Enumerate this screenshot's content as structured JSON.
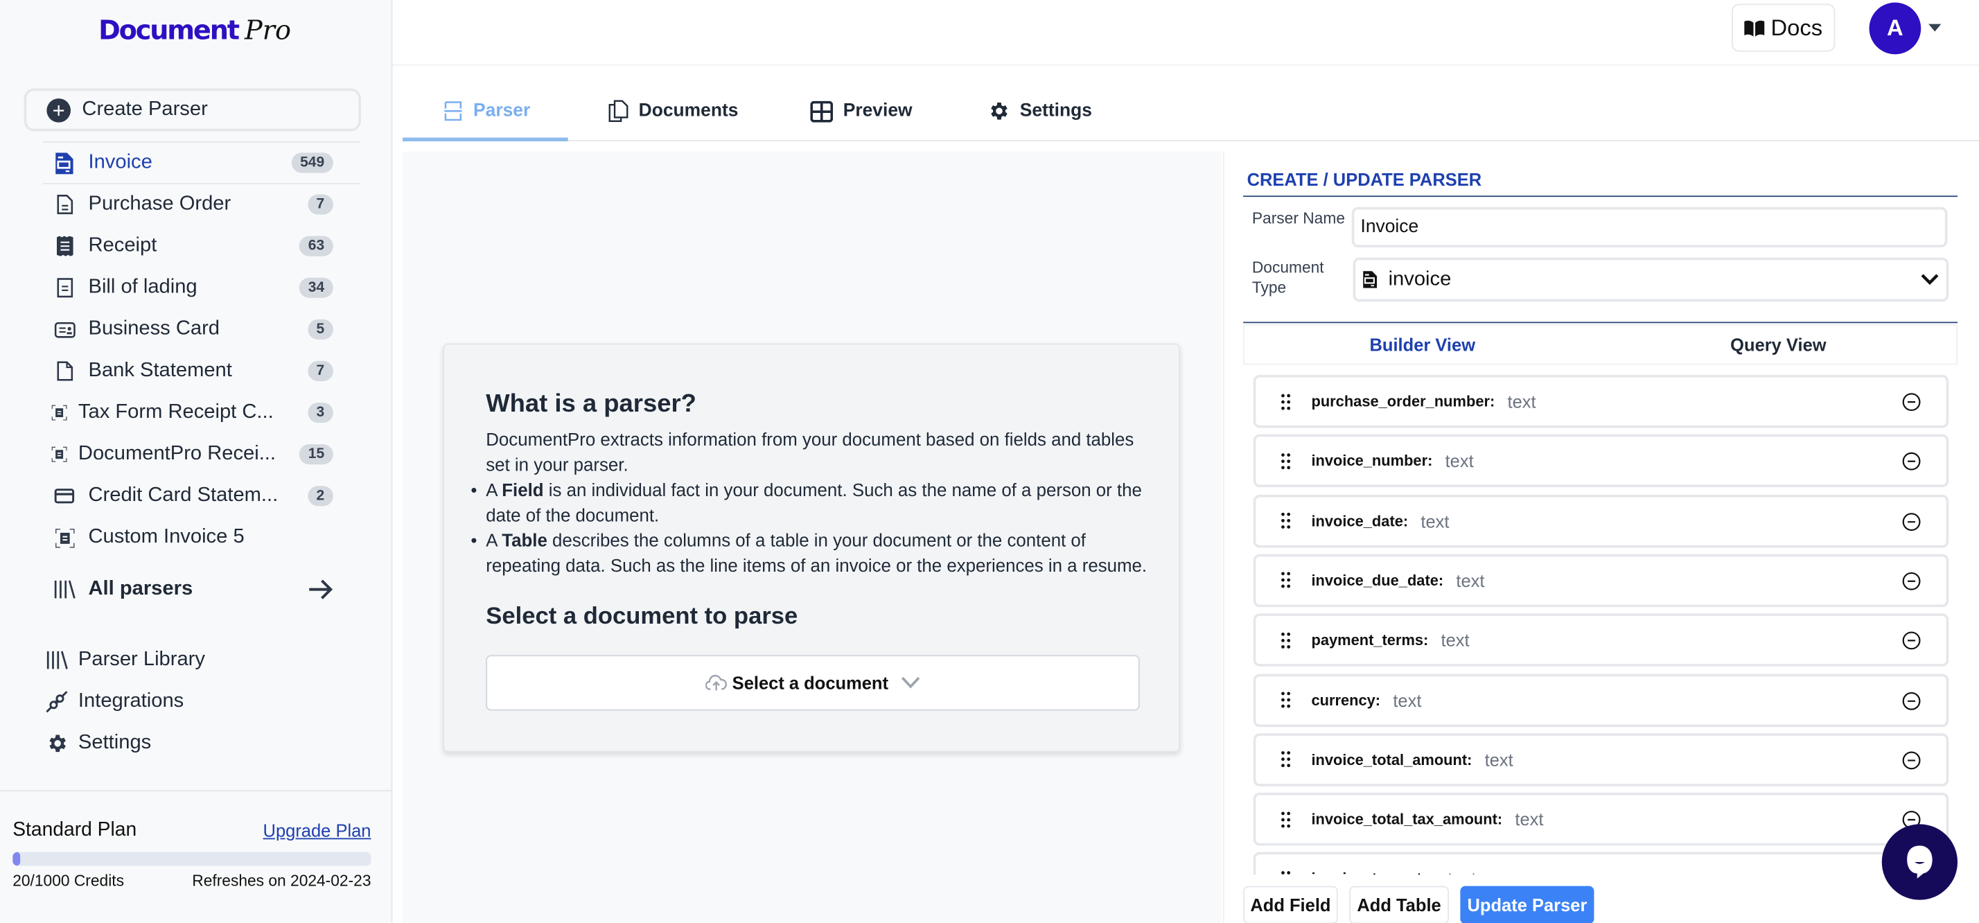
{
  "app": {
    "logo_main": "Document",
    "logo_accent": "Pro"
  },
  "sidebar": {
    "create_label": "Create Parser",
    "parsers": [
      {
        "label": "Invoice",
        "count": "549",
        "icon": "invoice-icon",
        "active": true
      },
      {
        "label": "Purchase Order",
        "count": "7",
        "icon": "document-outline-icon"
      },
      {
        "label": "Receipt",
        "count": "63",
        "icon": "receipt-icon"
      },
      {
        "label": "Bill of lading",
        "count": "34",
        "icon": "document-lines-icon"
      },
      {
        "label": "Business Card",
        "count": "5",
        "icon": "business-card-icon"
      },
      {
        "label": "Bank Statement",
        "count": "7",
        "icon": "blank-document-icon"
      },
      {
        "label": "Tax Form Receipt C...",
        "count": "3",
        "icon": "scan-document-icon"
      },
      {
        "label": "DocumentPro Recei...",
        "count": "15",
        "icon": "scan-document-icon"
      },
      {
        "label": "Credit Card Statem...",
        "count": "2",
        "icon": "credit-card-icon"
      },
      {
        "label": "Custom Invoice 5",
        "count": "",
        "icon": "scan-document-icon"
      }
    ],
    "all_parsers_label": "All parsers",
    "bottom_nav": [
      {
        "label": "Parser Library",
        "icon": "library-icon"
      },
      {
        "label": "Integrations",
        "icon": "plug-icon"
      },
      {
        "label": "Settings",
        "icon": "gear-icon"
      }
    ],
    "plan": {
      "name": "Standard Plan",
      "upgrade_label": "Upgrade Plan",
      "credits_label": "20/1000 Credits",
      "credits_used_fraction": 0.02,
      "refresh_label": "Refreshes on 2024-02-23"
    }
  },
  "topbar": {
    "docs_label": "Docs",
    "avatar_initial": "A"
  },
  "tabs": [
    {
      "label": "Parser",
      "active": true
    },
    {
      "label": "Documents"
    },
    {
      "label": "Preview"
    },
    {
      "label": "Settings"
    }
  ],
  "info_card": {
    "title": "What is a parser?",
    "intro": "DocumentPro extracts information from your document based on fields and tables set in your parser.",
    "bullets": [
      {
        "bold": "Field",
        "prefix": "A ",
        "text": " is an individual fact in your document. Such as the name of a person or the date of the document."
      },
      {
        "bold": "Table",
        "prefix": "A ",
        "text": " describes the columns of a table in your document or the content of repeating data. Such as the line items of an invoice or the experiences in a resume."
      }
    ],
    "select_title": "Select a document to parse",
    "select_label": "Select a document"
  },
  "parser_form": {
    "title": "CREATE / UPDATE PARSER",
    "name_label": "Parser Name",
    "name_value": "Invoice",
    "type_label_1": "Document",
    "type_label_2": "Type",
    "type_value": "invoice",
    "view_tabs": [
      {
        "label": "Builder View",
        "active": true
      },
      {
        "label": "Query View"
      }
    ],
    "fields": [
      {
        "name": "purchase_order_number:",
        "type": "text"
      },
      {
        "name": "invoice_number:",
        "type": "text"
      },
      {
        "name": "invoice_date:",
        "type": "text"
      },
      {
        "name": "invoice_due_date:",
        "type": "text"
      },
      {
        "name": "payment_terms:",
        "type": "text"
      },
      {
        "name": "currency:",
        "type": "text"
      },
      {
        "name": "invoice_total_amount:",
        "type": "text"
      },
      {
        "name": "invoice_total_tax_amount:",
        "type": "text"
      },
      {
        "name": "invoice_tax_rate:",
        "type": "text"
      }
    ],
    "add_field_label": "Add Field",
    "add_table_label": "Add Table",
    "update_label": "Update Parser"
  },
  "colors": {
    "brand": "#2e0fc2",
    "active_nav": "#1e40af",
    "primary_button": "#3b82f6",
    "active_tab": "#7aaef0"
  }
}
